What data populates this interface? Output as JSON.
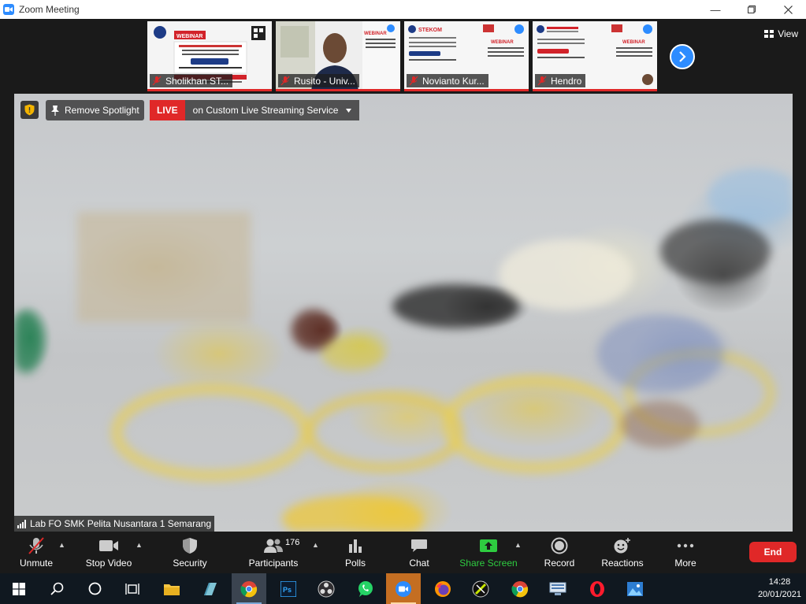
{
  "window": {
    "title": "Zoom Meeting",
    "controls": [
      "minimize",
      "maximize",
      "close"
    ]
  },
  "gallery": {
    "view_label": "View",
    "participants": [
      {
        "name": "Sholikhan ST...",
        "muted": true
      },
      {
        "name": "Rusito - Univ...",
        "muted": true
      },
      {
        "name": "Novianto Kur...",
        "muted": true
      },
      {
        "name": "Hendro",
        "muted": true
      }
    ],
    "poster_text": {
      "webinar": "WEBINAR",
      "stekom": "STEKOM"
    }
  },
  "spotlight": {
    "remove_label": "Remove Spotlight",
    "live_label": "LIVE",
    "live_service": "on Custom Live Streaming Service",
    "active_speaker": "Lab FO SMK Pelita Nusantara 1 Semarang"
  },
  "toolbar": {
    "unmute": "Unmute",
    "stop_video": "Stop Video",
    "security": "Security",
    "participants": "Participants",
    "participants_count": "176",
    "polls": "Polls",
    "chat": "Chat",
    "share_screen": "Share Screen",
    "record": "Record",
    "reactions": "Reactions",
    "more": "More",
    "end": "End"
  },
  "taskbar": {
    "time": "14:28",
    "date": "20/01/2021"
  },
  "colors": {
    "zoom_blue": "#2d8cff",
    "live_red": "#e02828",
    "share_green": "#2ecc40",
    "toolbar_bg": "#1a1a1a"
  }
}
